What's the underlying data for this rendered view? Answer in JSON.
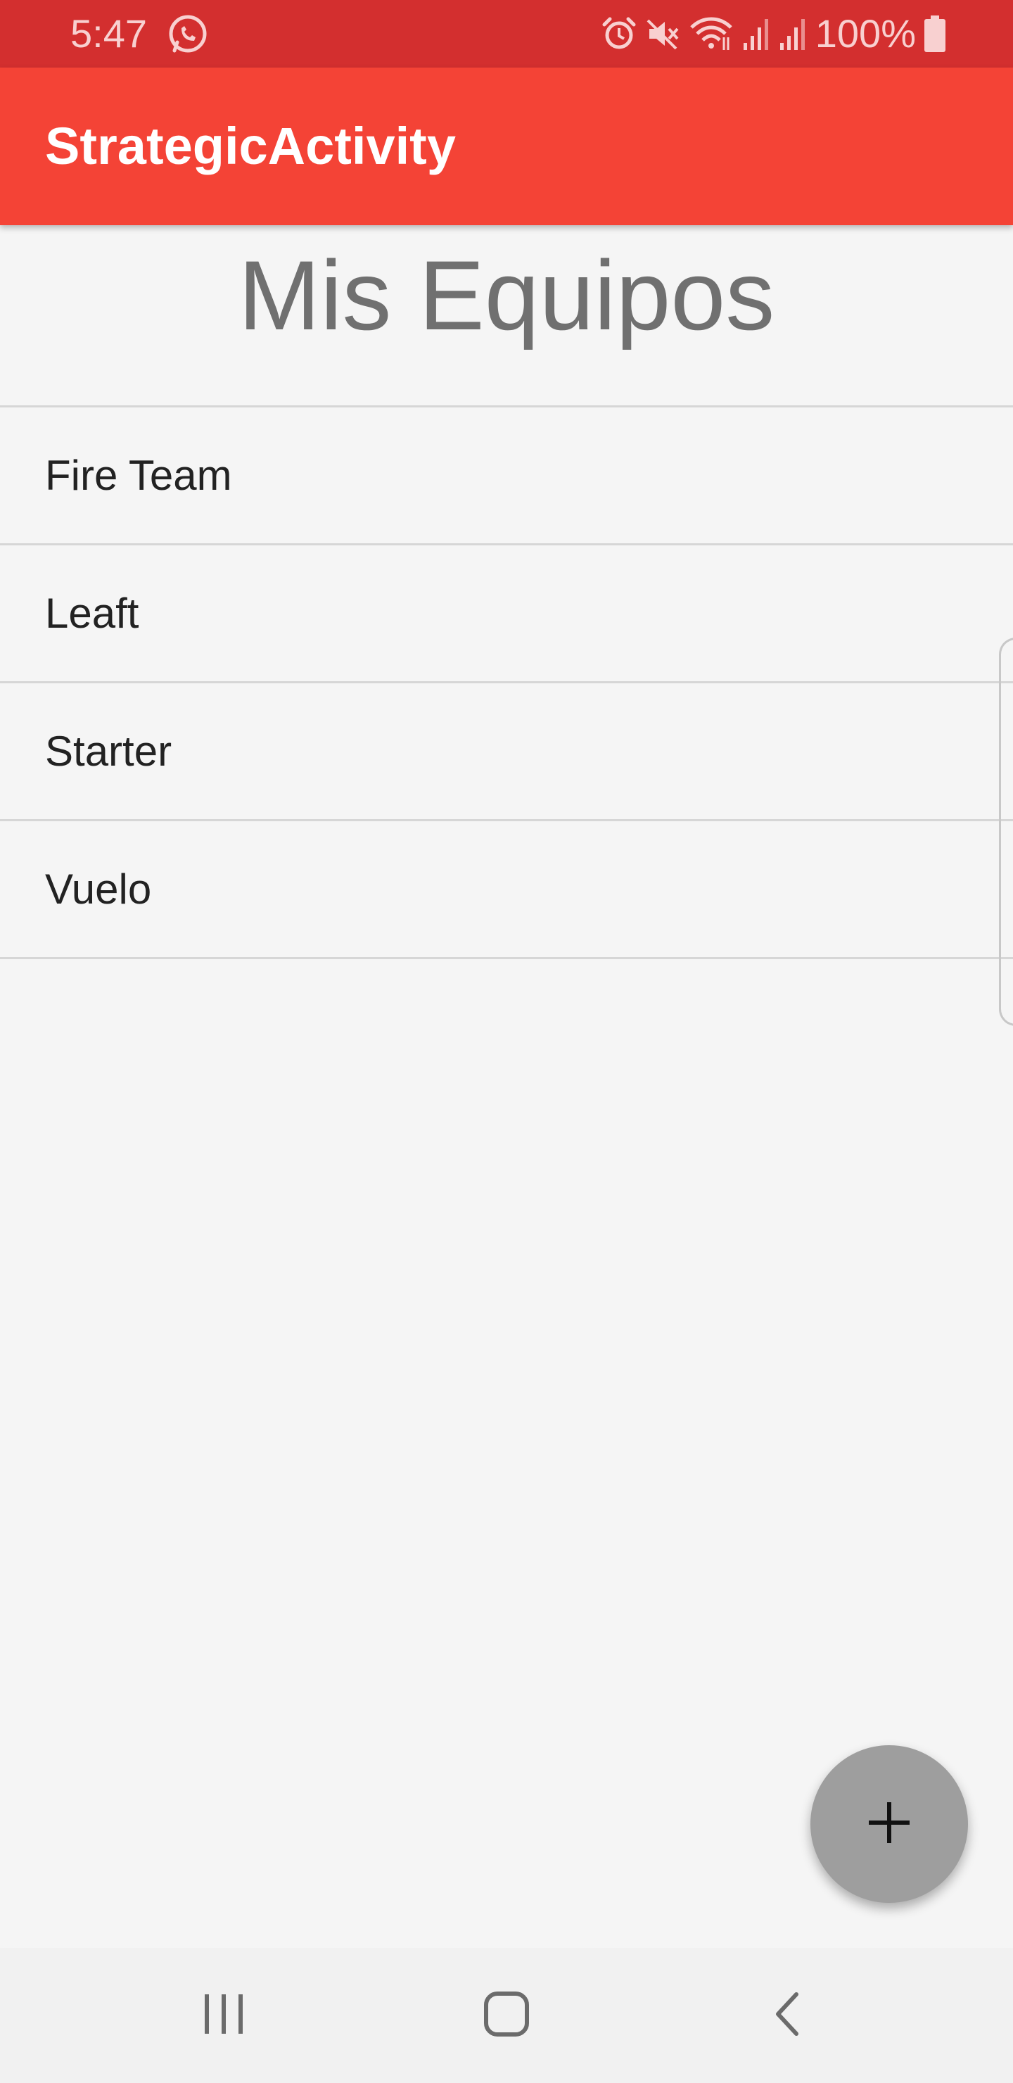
{
  "status_bar": {
    "time": "5:47",
    "battery_percent": "100%",
    "left_icons": [
      "whatsapp-icon"
    ],
    "right_icons": [
      "alarm-icon",
      "mute-icon",
      "wifi-icon",
      "signal-icon",
      "signal-icon",
      "battery-icon"
    ]
  },
  "app_bar": {
    "title": "StrategicActivity",
    "color": "#f44336"
  },
  "main": {
    "heading": "Mis Equipos",
    "teams": [
      {
        "name": "Fire Team"
      },
      {
        "name": "Leaft"
      },
      {
        "name": "Starter"
      },
      {
        "name": "Vuelo"
      }
    ]
  },
  "fab": {
    "icon": "plus-icon",
    "color": "#9e9e9e"
  },
  "nav_bar": {
    "buttons": [
      "recent-apps-icon",
      "home-icon",
      "back-icon"
    ]
  },
  "colors": {
    "status_bar": "#d32f2f",
    "background": "#f5f5f5",
    "divider": "#d6d6d6"
  }
}
